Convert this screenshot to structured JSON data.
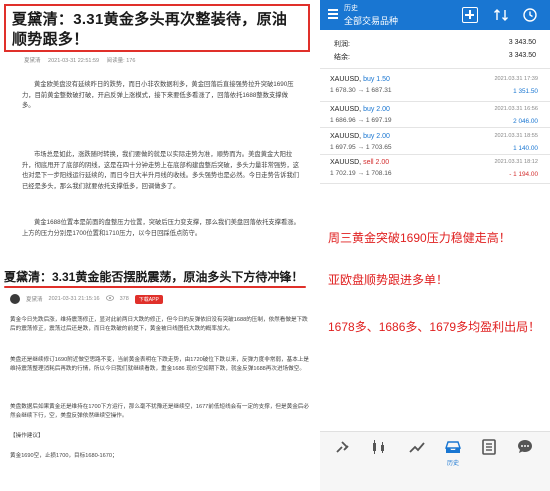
{
  "article1": {
    "title": "夏黛清：3.31黄金多头再次整装待，原油顺势跟多！",
    "author": "夏黛清",
    "date": "2021-03-31 22:51:59",
    "views": "阅读量: 176",
    "paragraphs": [
      "黄金欧美盘没有延续昨日的跌势，而日小非农数据利多，黄金回落后直接强势拉升突破1690压力，目前黄金整数破打破，开启反弹上涨模式，接下来要低多看涨了，回落依托1688整数支撑做多。",
      "市场总是如此，涨跌随时转换，我们要做的就是以实际走势为准，顺势而为。美盘黄金大阳拉升，彻底甩开了底部的阴线，这是在四十分钟走势上在底部构建盘整后突破，多头力量非常强势，这也对是下一步阳线运行延续的，而日今日大半升月线的收线。多头强势也是必然。今日走势告诉我们已经是多头，那么我们就要依托支撑低多，回调做多了。",
      "黄金1688位置本是前面的盘整压力位置，突破后压力变支撑，那么我们美盘回落依托支撑看涨。上方的压力分别是1700位置和1710压力，以今日回踩低点防守。"
    ]
  },
  "article2": {
    "title": "夏黛清：3.31黄金能否摆脱震荡，原油多头下方待冲锋！",
    "author": "夏黛清",
    "date": "2021-03-31 21:15:16",
    "views": "378",
    "badge": "下载APP",
    "paragraphs": [
      "黄金今日先跌后涨，维持震荡修正，显对此前两日大跌的修正，但今日的反弹依旧没有突破1688的压制，依然看做是下跌后的震荡修正，震荡过后还是跌，而日在跌破的前提下，黄金被日线图低大跌的概率加大。",
      "美盘还是继续修订1690附近做空思路不变，当前黄金表明在下跌走势，由1720破位下跌以来，反弹力度非常弱，基本上是维持震荡整理消耗后再跌的行情，所以今日我们就继续看跌，重金1686 现价空如期下跌，就金反弹1688再次进场做空。",
      "美盘数据后如果黄金还是维持在1700下方运行，那么毫不犹豫还是继续空，1677前低短线会有一定的支撑，但是黄金后必然会继续下行，空，美盘反弹依然继续空操作。",
      "【操作建议】",
      "黄金1690空，止损1700，目标1680-1670；"
    ]
  },
  "phone": {
    "header_title": "历史",
    "header_subtitle": "全部交易品种",
    "summary": [
      {
        "label": "利润:",
        "value": "3 343.50"
      },
      {
        "label": "结余:",
        "value": "3 343.50"
      }
    ],
    "positions": [
      {
        "symbol": "XAUUSD,",
        "side": "buy 1.50",
        "side_type": "buy",
        "prices": "1 678.30 → 1 687.31",
        "time": "2021.03.31 17:39",
        "pl": "1 351.50",
        "pl_type": "pos"
      },
      {
        "symbol": "XAUUSD,",
        "side": "buy 2.00",
        "side_type": "buy",
        "prices": "1 686.96 → 1 697.19",
        "time": "2021.03.31 16:56",
        "pl": "2 046.00",
        "pl_type": "pos"
      },
      {
        "symbol": "XAUUSD,",
        "side": "buy 2.00",
        "side_type": "buy",
        "prices": "1 697.95 → 1 703.65",
        "time": "2021.03.31 18:55",
        "pl": "1 140.00",
        "pl_type": "pos"
      },
      {
        "symbol": "XAUUSD,",
        "side": "sell 2.00",
        "side_type": "sell",
        "prices": "1 702.19 → 1 708.16",
        "time": "2021.03.31 18:12",
        "pl": "- 1 194.00",
        "pl_type": "neg"
      }
    ],
    "promo": [
      "周三黄金突破1690压力稳健走高！",
      "亚欧盘顺势跟进多单！",
      "1678多、1686多、1679多均盈利出局！"
    ],
    "tabs": [
      {
        "label": "",
        "icon": "quotes-icon"
      },
      {
        "label": "",
        "icon": "chart-icon"
      },
      {
        "label": "",
        "icon": "trade-icon"
      },
      {
        "label": "历史",
        "icon": "history-icon"
      },
      {
        "label": "",
        "icon": "news-icon"
      },
      {
        "label": "",
        "icon": "chat-icon"
      }
    ],
    "colors": {
      "accent": "#1976d2",
      "profit": "#1976d2",
      "loss": "#d32f2f",
      "promo": "#e02020"
    }
  }
}
